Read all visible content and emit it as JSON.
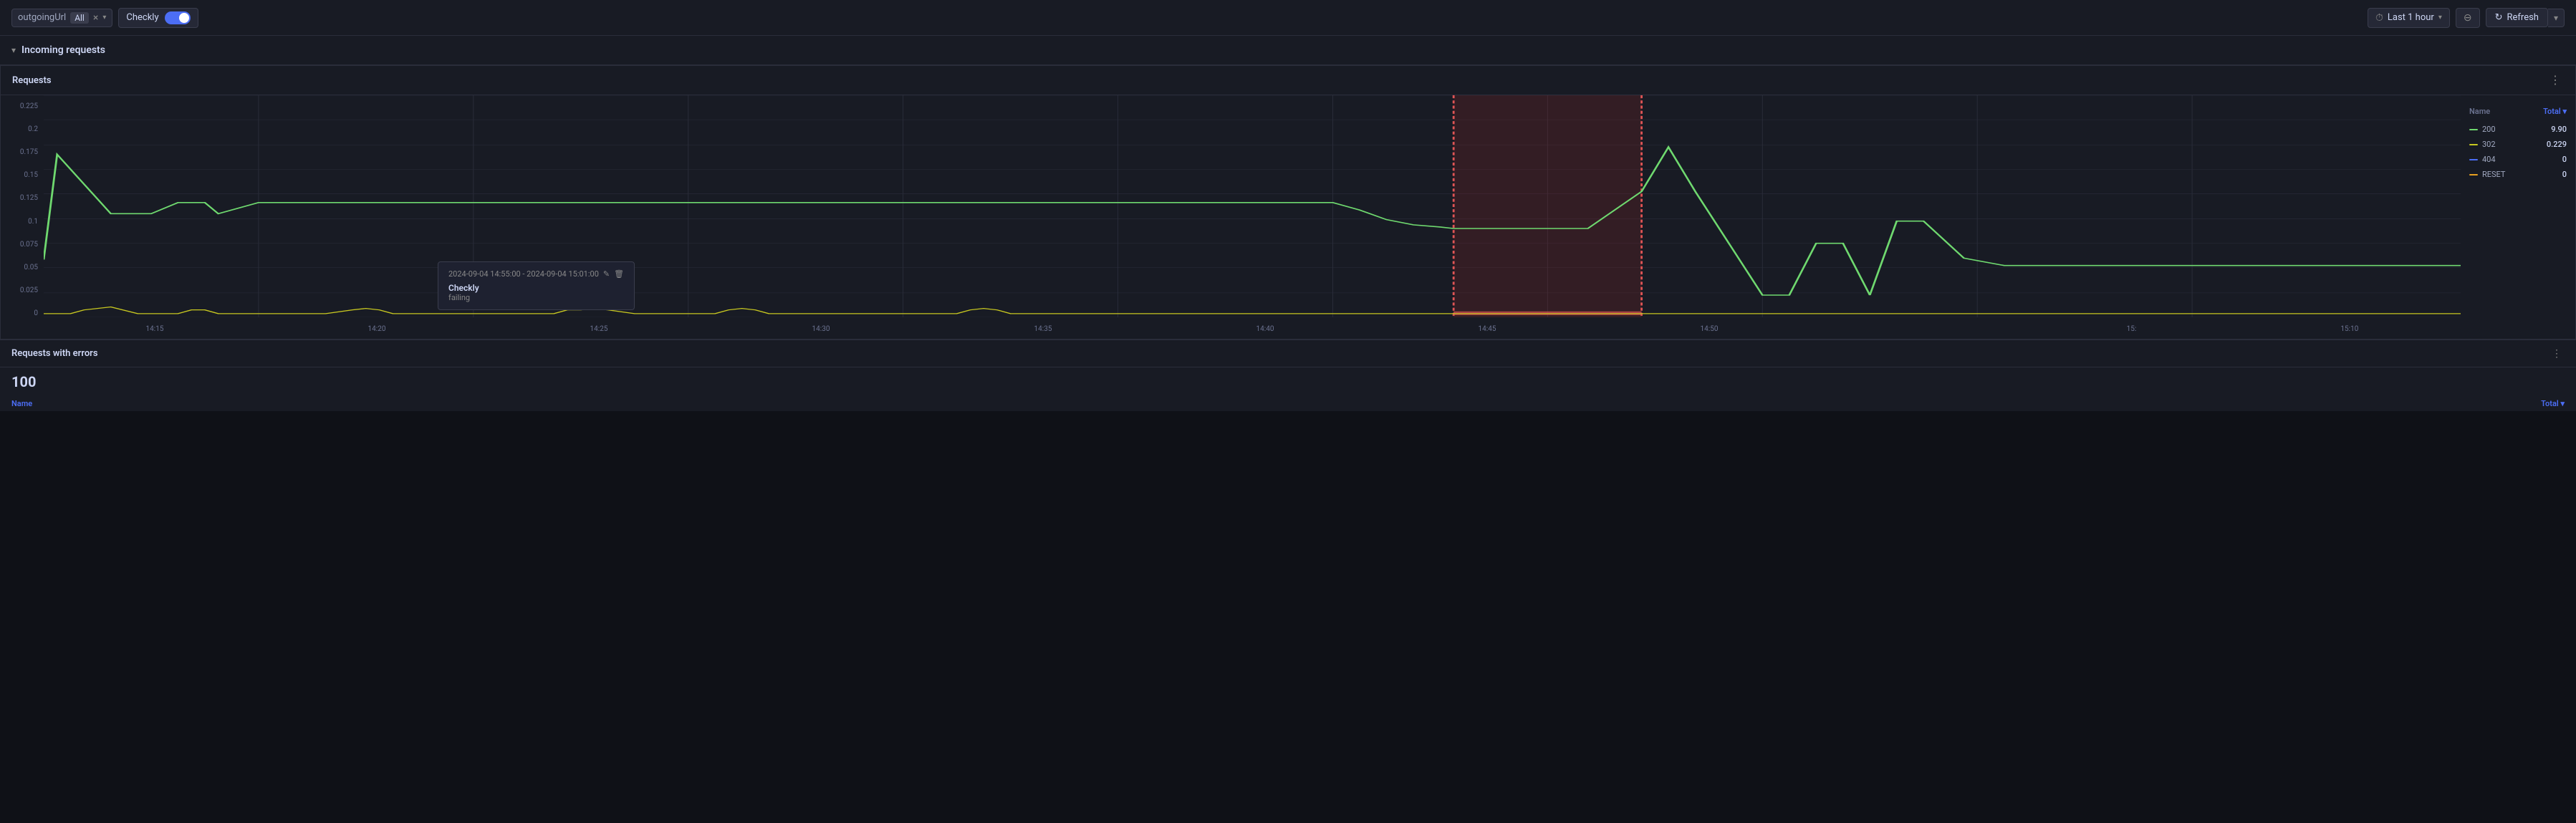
{
  "topbar": {
    "filter_label": "outgoingUrl",
    "filter_badge": "All",
    "filter_close": "×",
    "filter_dropdown": "▾",
    "checkly_label": "Checkly",
    "time_selector": "Last 1 hour",
    "refresh_label": "Refresh"
  },
  "section": {
    "title": "Incoming requests",
    "collapse_icon": "▾"
  },
  "requests_panel": {
    "title": "Requests",
    "menu_icon": "⋮",
    "y_axis": [
      "0.225",
      "0.2",
      "0.175",
      "0.15",
      "0.125",
      "0.1",
      "0.075",
      "0.05",
      "0.025",
      "0"
    ],
    "x_axis": [
      "14:15",
      "14:20",
      "14:25",
      "14:30",
      "14:35",
      "14:40",
      "14:45",
      "14:50",
      "",
      "15:",
      "15:10"
    ],
    "legend": {
      "name_label": "Name",
      "total_label": "Total ▾",
      "items": [
        {
          "name": "200",
          "color": "#6fd96f",
          "value": "9.90"
        },
        {
          "name": "302",
          "color": "#c8c820",
          "value": "0.229"
        },
        {
          "name": "404",
          "color": "#4c6ef5",
          "value": "0"
        },
        {
          "name": "RESET",
          "color": "#e8a020",
          "value": "0"
        }
      ]
    }
  },
  "tooltip": {
    "time_range": "2024-09-04 14:55:00 - 2024-09-04 15:01:00",
    "label": "Checkly",
    "sublabel": "failing"
  },
  "errors_panel": {
    "title": "Requests with errors",
    "value": "100",
    "name_label": "Name",
    "total_label": "Total ▾",
    "more_icon": "⋮"
  }
}
